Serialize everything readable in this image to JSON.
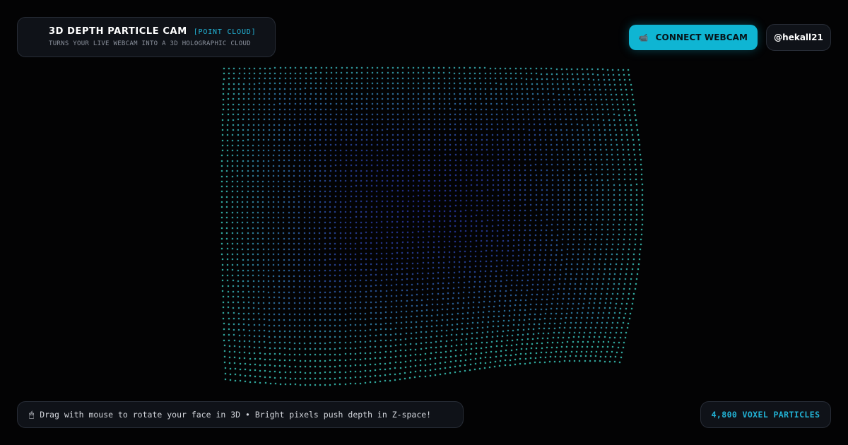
{
  "header": {
    "title": "3D DEPTH PARTICLE CAM",
    "tag": "[POINT CLOUD]",
    "subtitle": "TURNS YOUR LIVE WEBCAM INTO A 3D HOLOGRAPHIC CLOUD"
  },
  "actions": {
    "connect_icon": "camera-icon",
    "connect_icon_glyph": "📹",
    "connect_label": "CONNECT WEBCAM",
    "handle_label": "@hekall21"
  },
  "footer": {
    "hint_icon": "mouse-icon",
    "hint_icon_glyph": "🖱",
    "hint_text": "Drag with mouse to rotate your face in 3D • Bright pixels push depth in Z-space!",
    "particle_count": "4,800 VOXEL PARTICLES"
  },
  "colors": {
    "accent": "#0fb5d3",
    "accent_text": "#22b3d6",
    "background": "#030304",
    "particle_edge": "#3fd6c8",
    "particle_center": "#3a4fe6"
  }
}
